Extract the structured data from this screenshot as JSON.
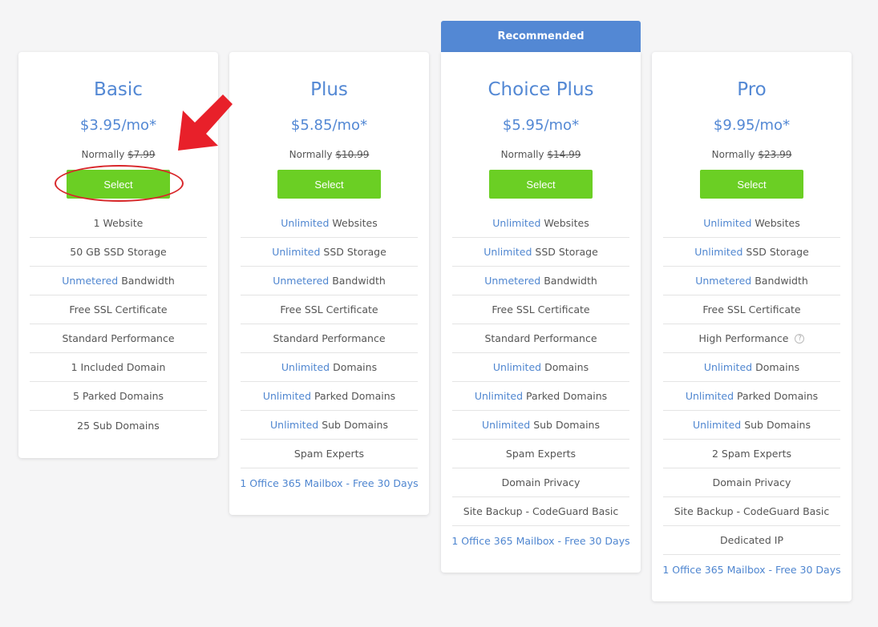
{
  "recommended_label": "Recommended",
  "normally_label": "Normally",
  "select_label": "Select",
  "colors": {
    "accent": "#5388d4",
    "select_green": "#6bcf24",
    "annotation_red": "#d8262a"
  },
  "plans": [
    {
      "name": "Basic",
      "price": "$3.95/mo*",
      "normal_price": "$7.99",
      "features": [
        {
          "hl": "",
          "text": "1 Website"
        },
        {
          "hl": "",
          "text": "50 GB SSD Storage"
        },
        {
          "hl": "Unmetered",
          "text": " Bandwidth"
        },
        {
          "hl": "",
          "text": "Free SSL Certificate"
        },
        {
          "hl": "",
          "text": "Standard Performance"
        },
        {
          "hl": "",
          "text": "1 Included Domain"
        },
        {
          "hl": "",
          "text": "5 Parked Domains"
        },
        {
          "hl": "",
          "text": "25 Sub Domains"
        }
      ]
    },
    {
      "name": "Plus",
      "price": "$5.85/mo*",
      "normal_price": "$10.99",
      "features": [
        {
          "hl": "Unlimited",
          "text": " Websites"
        },
        {
          "hl": "Unlimited",
          "text": " SSD Storage"
        },
        {
          "hl": "Unmetered",
          "text": " Bandwidth"
        },
        {
          "hl": "",
          "text": "Free SSL Certificate"
        },
        {
          "hl": "",
          "text": "Standard Performance"
        },
        {
          "hl": "Unlimited",
          "text": " Domains"
        },
        {
          "hl": "Unlimited",
          "text": " Parked Domains"
        },
        {
          "hl": "Unlimited",
          "text": " Sub Domains"
        },
        {
          "hl": "",
          "text": "Spam Experts"
        },
        {
          "hl": "",
          "text": "1 Office 365 Mailbox - Free 30 Days",
          "blue": true
        }
      ]
    },
    {
      "name": "Choice Plus",
      "price": "$5.95/mo*",
      "normal_price": "$14.99",
      "features": [
        {
          "hl": "Unlimited",
          "text": " Websites"
        },
        {
          "hl": "Unlimited",
          "text": " SSD Storage"
        },
        {
          "hl": "Unmetered",
          "text": " Bandwidth"
        },
        {
          "hl": "",
          "text": "Free SSL Certificate"
        },
        {
          "hl": "",
          "text": "Standard Performance"
        },
        {
          "hl": "Unlimited",
          "text": " Domains"
        },
        {
          "hl": "Unlimited",
          "text": " Parked Domains"
        },
        {
          "hl": "Unlimited",
          "text": " Sub Domains"
        },
        {
          "hl": "",
          "text": "Spam Experts"
        },
        {
          "hl": "",
          "text": "Domain Privacy"
        },
        {
          "hl": "",
          "text": "Site Backup - CodeGuard Basic"
        },
        {
          "hl": "",
          "text": "1 Office 365 Mailbox - Free 30 Days",
          "blue": true
        }
      ]
    },
    {
      "name": "Pro",
      "price": "$9.95/mo*",
      "normal_price": "$23.99",
      "features": [
        {
          "hl": "Unlimited",
          "text": " Websites"
        },
        {
          "hl": "Unlimited",
          "text": " SSD Storage"
        },
        {
          "hl": "Unmetered",
          "text": " Bandwidth"
        },
        {
          "hl": "",
          "text": "Free SSL Certificate"
        },
        {
          "hl": "",
          "text": "High Performance",
          "help": true
        },
        {
          "hl": "Unlimited",
          "text": " Domains"
        },
        {
          "hl": "Unlimited",
          "text": " Parked Domains"
        },
        {
          "hl": "Unlimited",
          "text": " Sub Domains"
        },
        {
          "hl": "",
          "text": "2 Spam Experts"
        },
        {
          "hl": "",
          "text": "Domain Privacy"
        },
        {
          "hl": "",
          "text": "Site Backup - CodeGuard Basic"
        },
        {
          "hl": "",
          "text": "Dedicated IP"
        },
        {
          "hl": "",
          "text": "1 Office 365 Mailbox - Free 30 Days",
          "blue": true
        }
      ]
    }
  ]
}
